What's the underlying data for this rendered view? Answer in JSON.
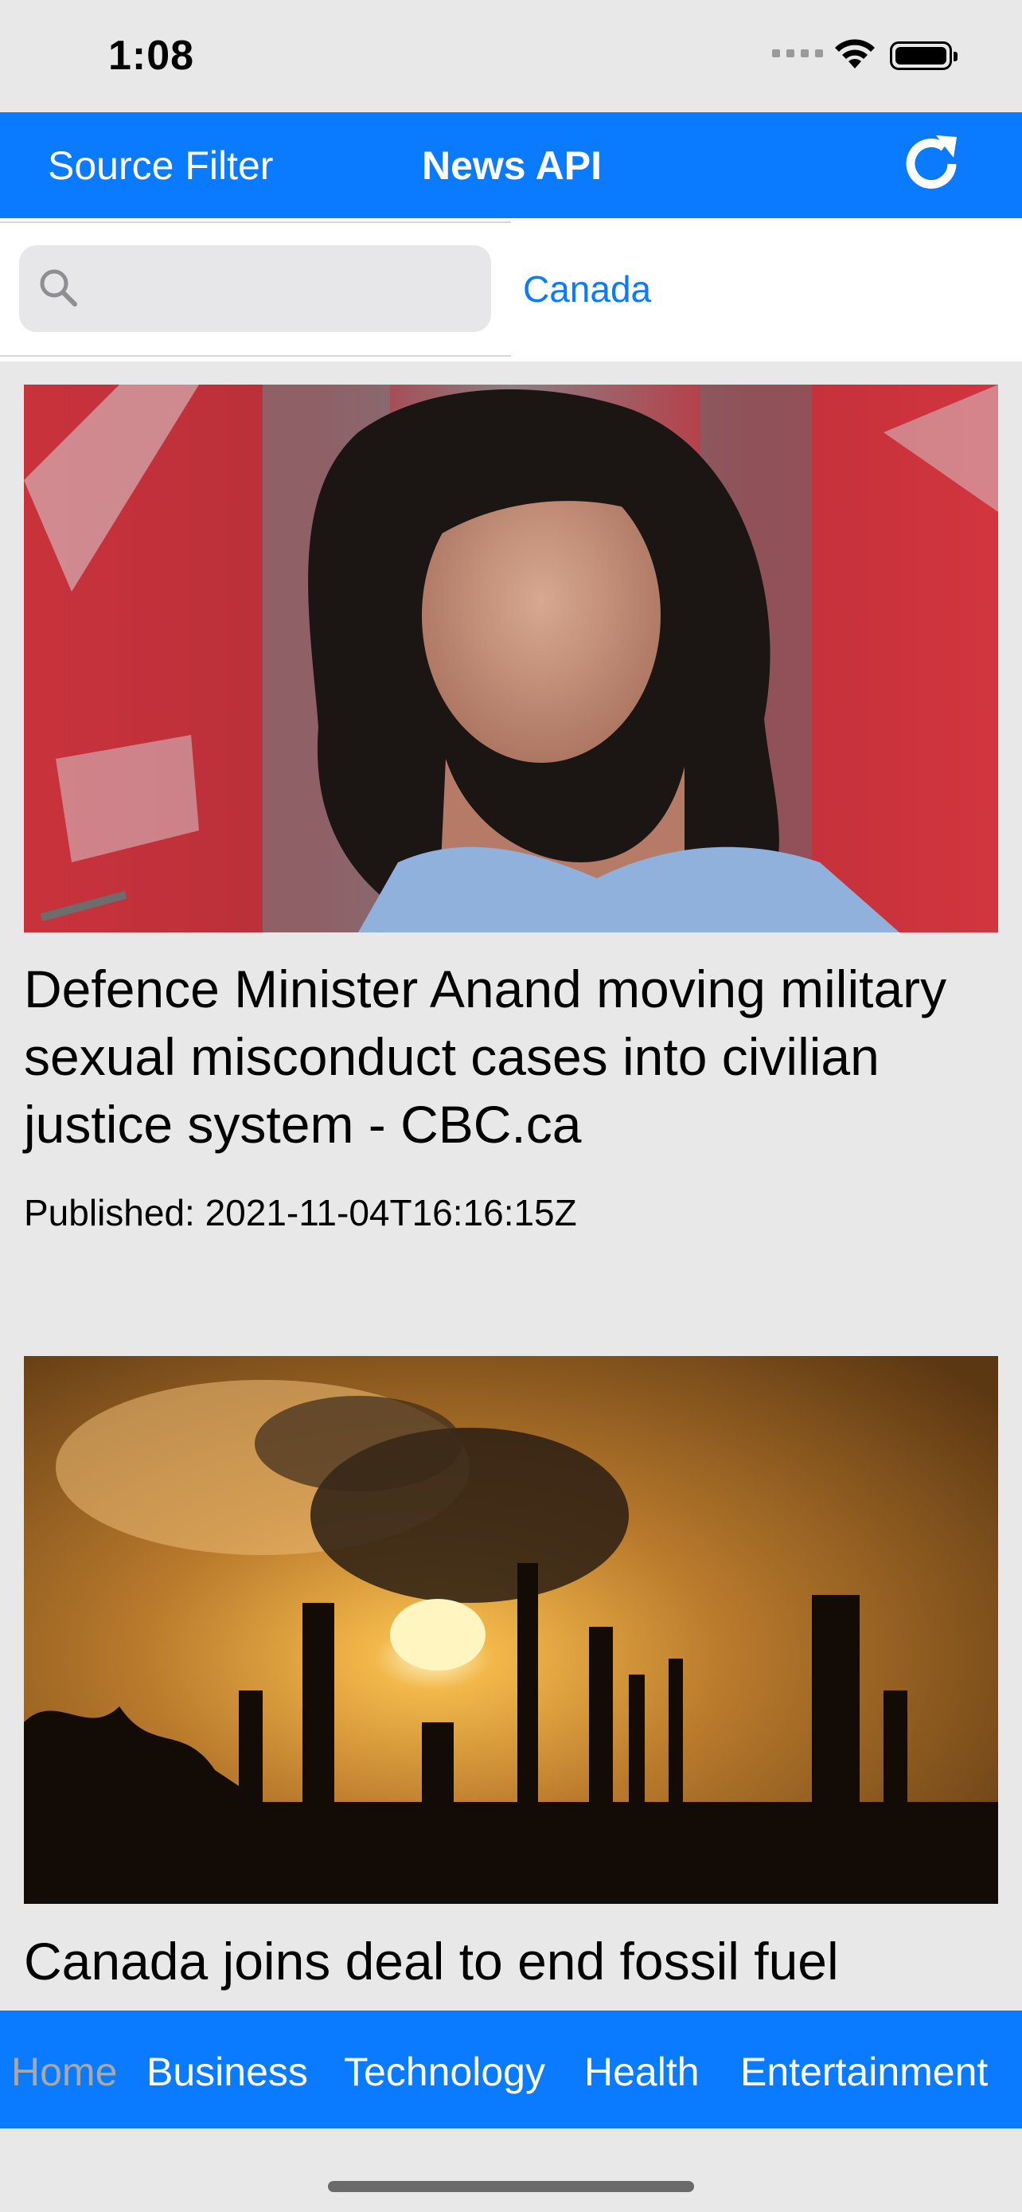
{
  "status": {
    "time": "1:08"
  },
  "nav": {
    "left_button": "Source Filter",
    "title": "News API",
    "refresh_icon": "refresh-icon"
  },
  "search": {
    "placeholder": "",
    "value": "",
    "country": "Canada"
  },
  "articles": [
    {
      "headline": "Defence Minister Anand moving military sexual misconduct cases into civilian justice system - CBC.ca",
      "published": "Published: 2021-11-04T16:16:15Z",
      "image_icon": "article-photo"
    },
    {
      "headline": "Canada joins deal to end fossil fuel",
      "published": "",
      "image_icon": "article-photo"
    }
  ],
  "tabs": [
    "Home",
    "Business",
    "Technology",
    "Health",
    "Entertainment"
  ],
  "colors": {
    "accent": "#0a7aff",
    "inactive_tab": "#a8a8a8",
    "background": "#e8e8e8"
  }
}
